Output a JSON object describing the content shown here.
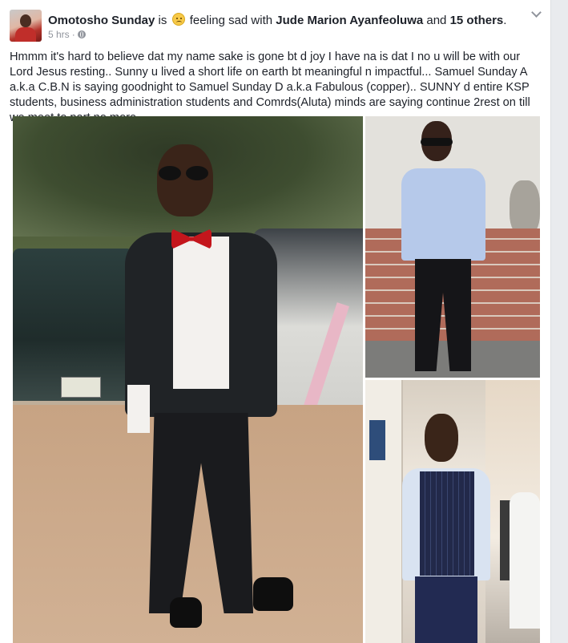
{
  "post": {
    "author": "Omotosho Sunday",
    "is_text": "is",
    "feeling_text": "feeling sad with",
    "tagged_person": "Jude Marion Ayanfeoluwa",
    "and_text": "and",
    "others": "15 others",
    "period": ".",
    "time": "5 hrs",
    "separator": "·",
    "privacy_icon": "globe-icon",
    "feeling_icon": "sad-face-emoji",
    "body": "Hmmm it's hard to believe dat my name sake is gone bt d joy I have na is dat I no u will be with our Lord Jesus resting.. Sunny u lived a short life on earth bt meaningful n impactful... Samuel Sunday A a.k.a C.B.N is saying goodnight to Samuel Sunday D a.k.a Fabulous (copper).. SUNNY d entire KSP students, business administration students and Comrds(Aluta) minds are saying continue 2rest on till we meet to part no more."
  },
  "colors": {
    "text": "#1d2129",
    "meta": "#90949c",
    "background": "#e9ebee",
    "card": "#ffffff"
  },
  "photos": [
    {
      "description": "man-in-black-suit-red-bowtie"
    },
    {
      "description": "man-in-blue-shirt-sunglasses"
    },
    {
      "description": "man-in-pinstripe-vest"
    }
  ]
}
